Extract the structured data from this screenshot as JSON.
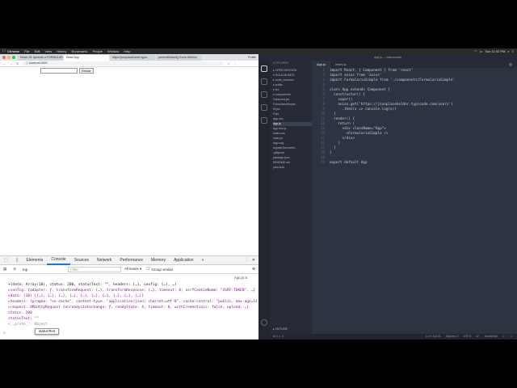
{
  "menubar": {
    "app": "Chrome",
    "items": [
      "File",
      "Edit",
      "View",
      "History",
      "Bookmarks",
      "People",
      "Window",
      "Help"
    ],
    "right": [
      "Sun 11:02 PM"
    ]
  },
  "chrome": {
    "tabs": [
      "React JS: Aprende a FORMULARIO",
      "React App",
      "https://jsonplaceholder.typic...",
      "preventDefault() Event Method"
    ],
    "active_tab_index": 1,
    "user": "Profile",
    "url": "localhost:3000",
    "page": {
      "button_label": "Enviar"
    }
  },
  "devtools": {
    "tabs": [
      "Elements",
      "Console",
      "Sources",
      "Network",
      "Performance",
      "Memory",
      "Application",
      "»"
    ],
    "active_tab": "Console",
    "context": "top",
    "filter_placeholder": "Filter",
    "levels": "All levels ▾",
    "group_similar": "Group similar",
    "source_link": "App.js:5",
    "lines": [
      "▾{data: Array(10), status: 200, statusText: \"\", headers: {…}, config: {…}, …}",
      " ▸config: {adapter: ƒ, transformRequest: {…}, transformResponse: {…}, timeout: 0, xsrfCookieName: \"XSRF-TOKEN\", …}",
      " ▸data: (10) [{…}, {…}, {…}, {…}, {…}, {…}, {…}, {…}, {…}, {…}]",
      " ▸headers: {pragma: \"no-cache\", content-type: \"application/json; charset=utf-8\", cache-control: \"public, max-age=14400\"}",
      " ▸request: XMLHttpRequest {onreadystatechange: ƒ, readyState: 4, timeout: 0, withCredentials: false, upload: …}",
      "  status: 200",
      "  statusText: \"\"",
      " ▸__proto__: Object"
    ],
    "tooltip": "statusText",
    "prompt": ">"
  },
  "vscode": {
    "title": "App.js — hola-mundo",
    "tabs": [
      "App.js",
      "index.js"
    ],
    "explorer_title": "EXPLORER",
    "tree": [
      "▸ OPEN EDITORS",
      "▾ HOLA-MUNDO",
      "  ▸ node_modules",
      "  ▸ public",
      "  ▾ src",
      "    ▾ components",
      "        Cabecera.jsx",
      "        FormularioSimple...",
      "        Hi.jsx",
      "        P.jsx",
      "      App.css",
      "      App.js",
      "      App.test.js",
      "      index.css",
      "      index.js",
      "      logo.svg",
      "      registerServiceW...",
      "    .gitignore",
      "    package.json",
      "    README.md",
      "    yarn.lock"
    ],
    "outline": "▸ OUTLINE",
    "code": [
      "import React, { Component } from 'react'",
      "import axios from 'axios'",
      "import FormularioSimple from './components/FormularioSimple'",
      "",
      "class App extends Component {",
      "  constructor() {",
      "    super()",
      "    axios.get('https://jsonplaceholder.typicode.com/users')",
      "      .then(x => console.log(x))",
      "  }",
      "  render() {",
      "    return (",
      "      <div className=\"App\">",
      "        <FormularioSimple />",
      "      </div>",
      "    )",
      "  }",
      "}",
      "",
      "export default App"
    ],
    "status_left": "⊗ 0  ⚠ 0",
    "status_right": [
      "Ln 9, Col 31",
      "Spaces: 2",
      "UTF-8",
      "LF",
      "JavaScript"
    ]
  }
}
